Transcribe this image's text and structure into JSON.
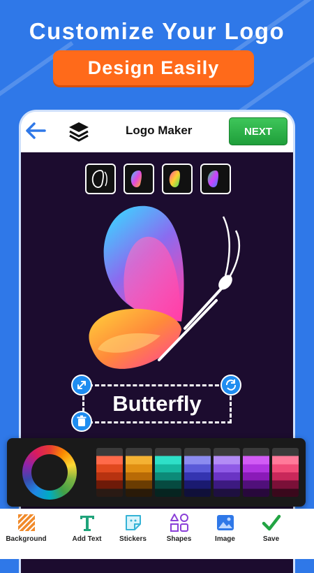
{
  "promo": {
    "headline": "Customize Your Logo",
    "subheadline": "Design Easily"
  },
  "topbar": {
    "title": "Logo Maker",
    "next_label": "NEXT"
  },
  "canvas": {
    "logo_text": "Butterfly",
    "background_color": "#1c0c2f"
  },
  "palette": {
    "swatches": [
      [
        "#3a3a3a",
        "#ff6a4a",
        "#e0481e",
        "#b73210",
        "#6e1a08",
        "#2a1a14"
      ],
      [
        "#3a3a3a",
        "#f4b233",
        "#e08f12",
        "#b86a06",
        "#6a3c02",
        "#2a1a08"
      ],
      [
        "#3a3a3a",
        "#2ee0c8",
        "#16b8a0",
        "#0c8a78",
        "#064a40",
        "#062420"
      ],
      [
        "#3a3a3a",
        "#8c8cf0",
        "#5a5ad8",
        "#3434b0",
        "#1a1a70",
        "#10103a"
      ],
      [
        "#3a3a3a",
        "#b38cf5",
        "#8f5ae6",
        "#6a34c4",
        "#3c1a80",
        "#1e1040"
      ],
      [
        "#3a3a3a",
        "#d25cf5",
        "#b034e0",
        "#8a1ab8",
        "#50107a",
        "#28083c"
      ],
      [
        "#3a3a3a",
        "#ff7a9a",
        "#f04c78",
        "#c8285a",
        "#7a1038",
        "#3a081c"
      ]
    ]
  },
  "toolbar": {
    "items": [
      {
        "label": "Background",
        "icon": "background-icon"
      },
      {
        "label": "Add Text",
        "icon": "text-icon"
      },
      {
        "label": "Stickers",
        "icon": "sticker-icon"
      },
      {
        "label": "Shapes",
        "icon": "shapes-icon"
      },
      {
        "label": "Image",
        "icon": "image-icon"
      },
      {
        "label": "Save",
        "icon": "check-icon"
      }
    ]
  },
  "colors": {
    "brand_blue": "#2f78e8",
    "accent_orange": "#ff6a1a",
    "next_green": "#2fb24a"
  }
}
